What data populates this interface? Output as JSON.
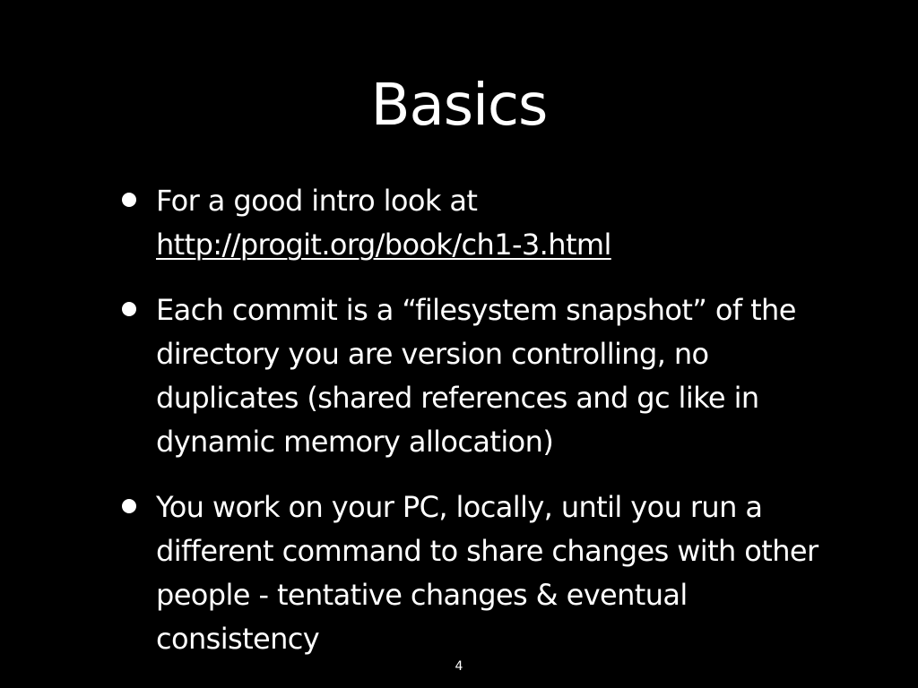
{
  "slide": {
    "title": "Basics",
    "bullets": [
      {
        "text": "For a good intro look at ",
        "link": "http://progit.org/book/ch1-3.html"
      },
      {
        "text": "Each commit is a “filesystem snapshot” of the directory you are version controlling, no duplicates (shared references and gc like in dynamic memory allocation)"
      },
      {
        "text": "You work on your PC, locally, until you run a different command to share changes with other people - tentative changes & eventual consistency"
      }
    ],
    "page_number": "4"
  },
  "colors": {
    "background": "#000000",
    "text": "#ffffff"
  },
  "icons": {
    "bullet": "bullet-dot-icon"
  }
}
